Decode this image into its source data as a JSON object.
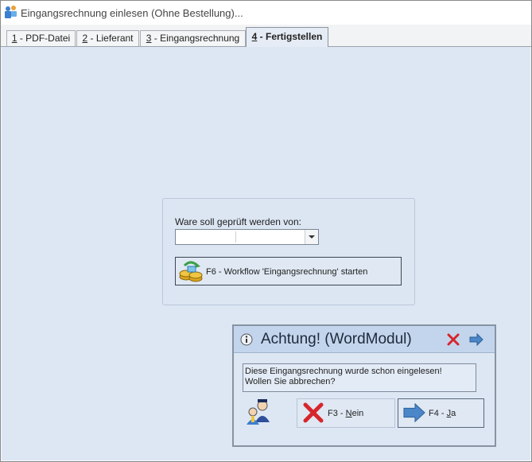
{
  "window": {
    "title": "Eingangsrechnung einlesen (Ohne Bestellung)..."
  },
  "tabs": [
    {
      "hotkey": "1",
      "label": " - PDF-Datei"
    },
    {
      "hotkey": "2",
      "label": " - Lieferant"
    },
    {
      "hotkey": "3",
      "label": " - Eingangsrechnung"
    },
    {
      "hotkey": "4",
      "label": " - Fertigstellen"
    }
  ],
  "panel": {
    "label": "Ware soll geprüft werden von:",
    "combo_value": "",
    "workflow_button": "F6 - Workflow 'Eingangsrechnung' starten"
  },
  "dialog": {
    "title": "Achtung! (WordModul)",
    "message_line1": "Diese Eingangsrechnung wurde schon eingelesen!",
    "message_line2": "Wollen Sie abbrechen?",
    "no_prefix": "F3 - ",
    "no_hotkey": "N",
    "no_rest": "ein",
    "yes_prefix": "F4 - ",
    "yes_hotkey": "J",
    "yes_rest": "a"
  },
  "icons": {
    "app": "app-person-icon",
    "workflow": "coins-workflow-icon",
    "info": "info-icon",
    "close": "red-x-icon",
    "next": "blue-arrow-icon",
    "avatar": "users-avatar-icon"
  },
  "colors": {
    "accent": "#c3d5ec",
    "close_red": "#d6262b",
    "arrow_blue": "#4a86c8"
  }
}
